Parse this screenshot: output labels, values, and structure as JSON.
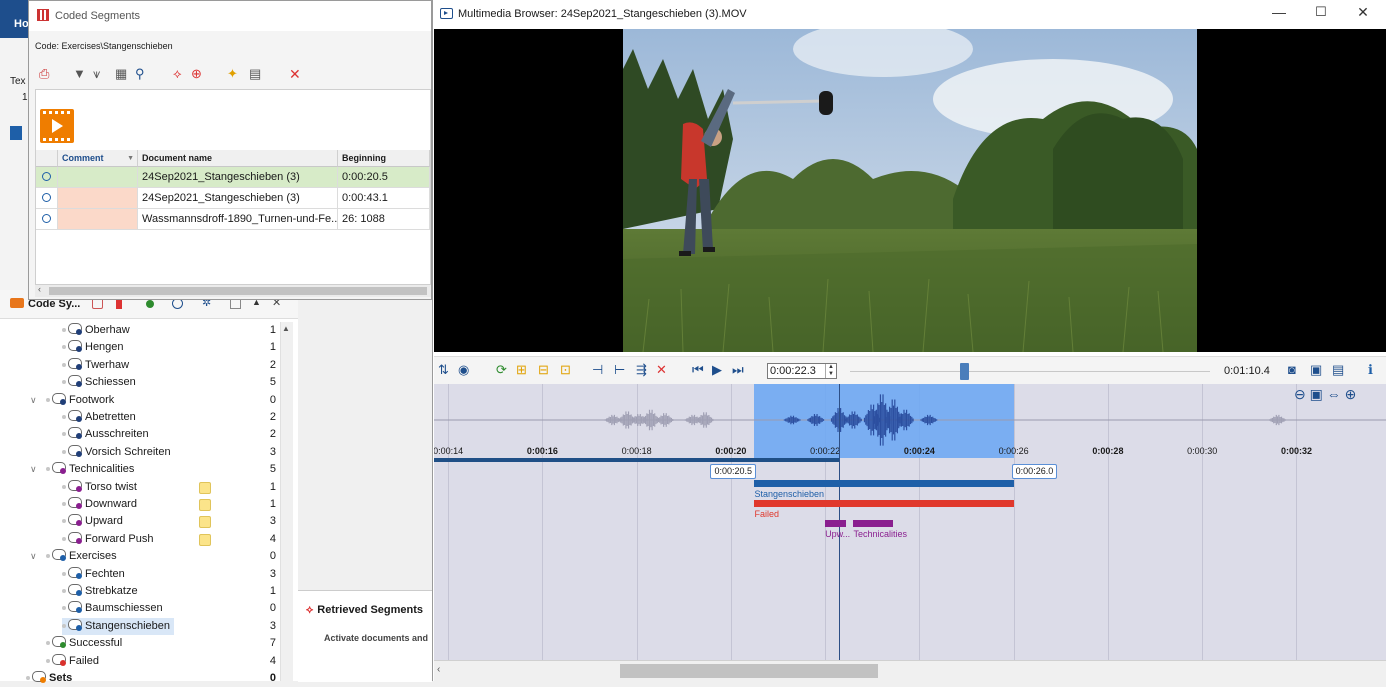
{
  "app": {
    "home_tab": "Ho",
    "text_label": "Tex",
    "text_count": "1"
  },
  "code_system": {
    "title": "Code Sy...",
    "items": [
      {
        "label": "Oberhaw",
        "count": "1",
        "level": 3,
        "caret": "",
        "memo": false,
        "color": "#203e78"
      },
      {
        "label": "Hengen",
        "count": "1",
        "level": 3,
        "caret": "",
        "memo": false,
        "color": "#203e78"
      },
      {
        "label": "Twerhaw",
        "count": "2",
        "level": 3,
        "caret": "",
        "memo": false,
        "color": "#203e78"
      },
      {
        "label": "Schiessen",
        "count": "5",
        "level": 3,
        "caret": "",
        "memo": false,
        "color": "#203e78"
      },
      {
        "label": "Footwork",
        "count": "0",
        "level": 2,
        "caret": "v",
        "memo": false,
        "color": "#203e78"
      },
      {
        "label": "Abetretten",
        "count": "2",
        "level": 3,
        "caret": "",
        "memo": false,
        "color": "#203e78"
      },
      {
        "label": "Ausschreiten",
        "count": "2",
        "level": 3,
        "caret": "",
        "memo": false,
        "color": "#203e78"
      },
      {
        "label": "Vorsich Schreiten",
        "count": "3",
        "level": 3,
        "caret": "",
        "memo": false,
        "color": "#203e78"
      },
      {
        "label": "Technicalities",
        "count": "5",
        "level": 2,
        "caret": "v",
        "memo": false,
        "color": "#8a1f8f"
      },
      {
        "label": "Torso twist",
        "count": "1",
        "level": 3,
        "caret": "",
        "memo": true,
        "color": "#8a1f8f"
      },
      {
        "label": "Downward",
        "count": "1",
        "level": 3,
        "caret": "",
        "memo": true,
        "color": "#8a1f8f"
      },
      {
        "label": "Upward",
        "count": "3",
        "level": 3,
        "caret": "",
        "memo": true,
        "color": "#8a1f8f"
      },
      {
        "label": "Forward Push",
        "count": "4",
        "level": 3,
        "caret": "",
        "memo": true,
        "color": "#8a1f8f"
      },
      {
        "label": "Exercises",
        "count": "0",
        "level": 2,
        "caret": "v",
        "memo": false,
        "color": "#1e5fa8"
      },
      {
        "label": "Fechten",
        "count": "3",
        "level": 3,
        "caret": "",
        "memo": false,
        "color": "#1e5fa8"
      },
      {
        "label": "Strebkatze",
        "count": "1",
        "level": 3,
        "caret": "",
        "memo": false,
        "color": "#1e5fa8"
      },
      {
        "label": "Baumschiessen",
        "count": "0",
        "level": 3,
        "caret": "",
        "memo": false,
        "color": "#1e5fa8"
      },
      {
        "label": "Stangenschieben",
        "count": "3",
        "level": 3,
        "caret": "",
        "memo": false,
        "color": "#1e5fa8",
        "selected": true
      },
      {
        "label": "Successful",
        "count": "7",
        "level": 2,
        "caret": "",
        "memo": false,
        "color": "#2e8b2e"
      },
      {
        "label": "Failed",
        "count": "4",
        "level": 2,
        "caret": "",
        "memo": false,
        "color": "#d9302c"
      },
      {
        "label": "Sets",
        "count": "0",
        "level": 1,
        "caret": "",
        "memo": false,
        "color": "#ef7d00"
      }
    ]
  },
  "retrieved": {
    "title": "Retrieved Segments",
    "hint": "Activate documents and"
  },
  "coded_segments": {
    "title": "Coded Segments",
    "code_path": "Code: Exercises\\Stangenschieben",
    "columns": {
      "comment": "Comment",
      "document": "Document name",
      "beginning": "Beginning"
    },
    "rows": [
      {
        "comment": "",
        "document": "24Sep2021_Stangeschieben (3)",
        "beginning": "0:00:20.5",
        "row_color": "#d7ebc8",
        "comment_color": "#d7ebc8"
      },
      {
        "comment": "",
        "document": "24Sep2021_Stangeschieben (3)",
        "beginning": "0:00:43.1",
        "row_color": "#ffffff",
        "comment_color": "#fbd9c9"
      },
      {
        "comment": "",
        "document": "Wassmannsdroff-1890_Turnen-und-Fe...",
        "beginning": "26: 1088",
        "row_color": "#ffffff",
        "comment_color": "#fbd9c9"
      }
    ]
  },
  "multimedia": {
    "title": "Multimedia Browser:  24Sep2021_Stangeschieben (3).MOV",
    "current_time": "0:00:22.3",
    "duration": "0:01:10.4",
    "slider_position": 0.318,
    "timeline": {
      "start_seconds": 13.7,
      "end_seconds": 33.9,
      "ticks": [
        {
          "t": 14,
          "label": "0:00:14",
          "bold": false
        },
        {
          "t": 16,
          "label": "0:00:16",
          "bold": true
        },
        {
          "t": 18,
          "label": "0:00:18",
          "bold": false
        },
        {
          "t": 20,
          "label": "0:00:20",
          "bold": true
        },
        {
          "t": 22,
          "label": "0:00:22",
          "bold": false
        },
        {
          "t": 24,
          "label": "0:00:24",
          "bold": true
        },
        {
          "t": 26,
          "label": "0:00:26",
          "bold": false
        },
        {
          "t": 28,
          "label": "0:00:28",
          "bold": true
        },
        {
          "t": 30,
          "label": "0:00:30",
          "bold": false
        },
        {
          "t": 32,
          "label": "0:00:32",
          "bold": true
        }
      ],
      "selection": {
        "start": 20.5,
        "end": 26.0,
        "start_label": "0:00:20.5",
        "end_label": "0:00:26.0"
      },
      "played_until": 22.3,
      "segments": [
        {
          "name": "Stangenschieben",
          "start": 20.5,
          "end": 26.0,
          "color": "#1e5fa8",
          "row": 0
        },
        {
          "name": "Failed",
          "start": 20.5,
          "end": 26.0,
          "color": "#e0382c",
          "row": 1
        },
        {
          "name": "Upw...",
          "start": 22.0,
          "end": 22.45,
          "color": "#8a1f8f",
          "row": 2
        },
        {
          "name": "Technicalities",
          "start": 22.6,
          "end": 23.45,
          "color": "#8a1f8f",
          "row": 2
        }
      ]
    }
  },
  "icons": {
    "close": "✕",
    "minimize": "—",
    "maximize": "☐",
    "info": "ℹ"
  }
}
